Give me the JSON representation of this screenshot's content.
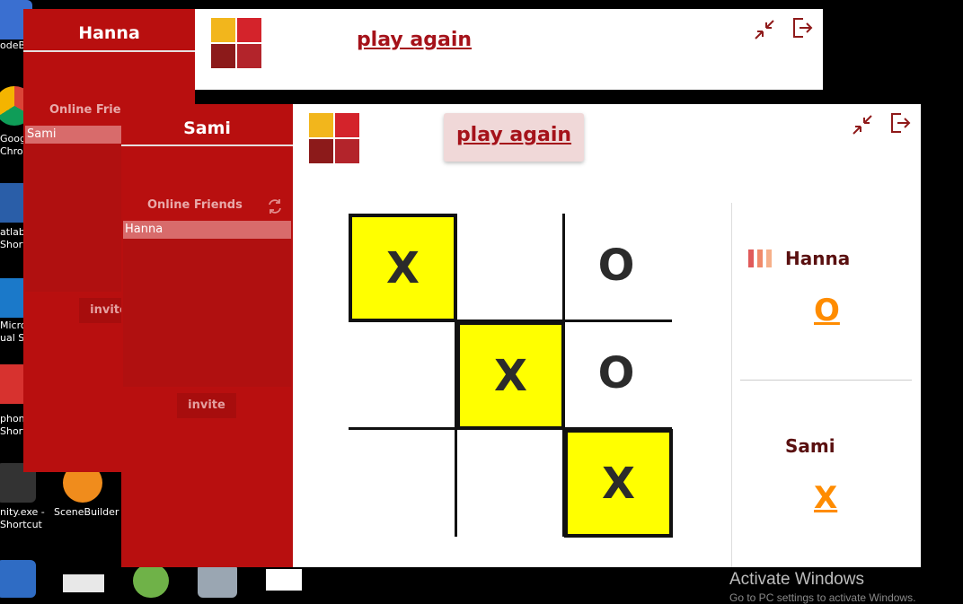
{
  "desktop": {
    "icons": [
      {
        "label_line1": "odeBl",
        "label_line2": ""
      },
      {
        "label_line1": "Goog",
        "label_line2": "Chro"
      },
      {
        "label_line1": "atlab.",
        "label_line2": "Short"
      },
      {
        "label_line1": "Micros",
        "label_line2": "ual S"
      },
      {
        "label_line1": "phon",
        "label_line2": "Short"
      },
      {
        "label_line1": "nity.exe -",
        "label_line2": "Shortcut"
      },
      {
        "label_line1": "SceneBuilder",
        "label_line2": ""
      }
    ],
    "activate_line1": "Activate Windows",
    "activate_line2": "Go to PC settings to activate Windows."
  },
  "window_hanna": {
    "player_name": "Hanna",
    "online_friends_label": "Online Frien",
    "selected_friend": "Sami",
    "invite_label": "invite",
    "play_again_label": "play again"
  },
  "window_sami": {
    "player_name": "Sami",
    "online_friends_label": "Online Friends",
    "selected_friend": "Hanna",
    "invite_label": "invite",
    "play_again_label": "play again",
    "board": [
      {
        "value": "X",
        "win": true
      },
      {
        "value": "",
        "win": false
      },
      {
        "value": "O",
        "win": false
      },
      {
        "value": "",
        "win": false
      },
      {
        "value": "X",
        "win": true
      },
      {
        "value": "O",
        "win": false
      },
      {
        "value": "",
        "win": false
      },
      {
        "value": "",
        "win": false
      },
      {
        "value": "X",
        "win": true
      }
    ],
    "players": [
      {
        "name": "Hanna",
        "symbol": "O",
        "has_turn_indicator": true
      },
      {
        "name": "Sami",
        "symbol": "X",
        "has_turn_indicator": false
      }
    ]
  },
  "colors": {
    "sidebar_red": "#b80f0f",
    "winning_cell": "#ffff00",
    "symbol_orange": "#ff8c00",
    "logo_yellow": "#f2b61c",
    "logo_red": "#d4232b",
    "logo_dark": "#8c1a1a",
    "logo_mid": "#b3242b"
  }
}
